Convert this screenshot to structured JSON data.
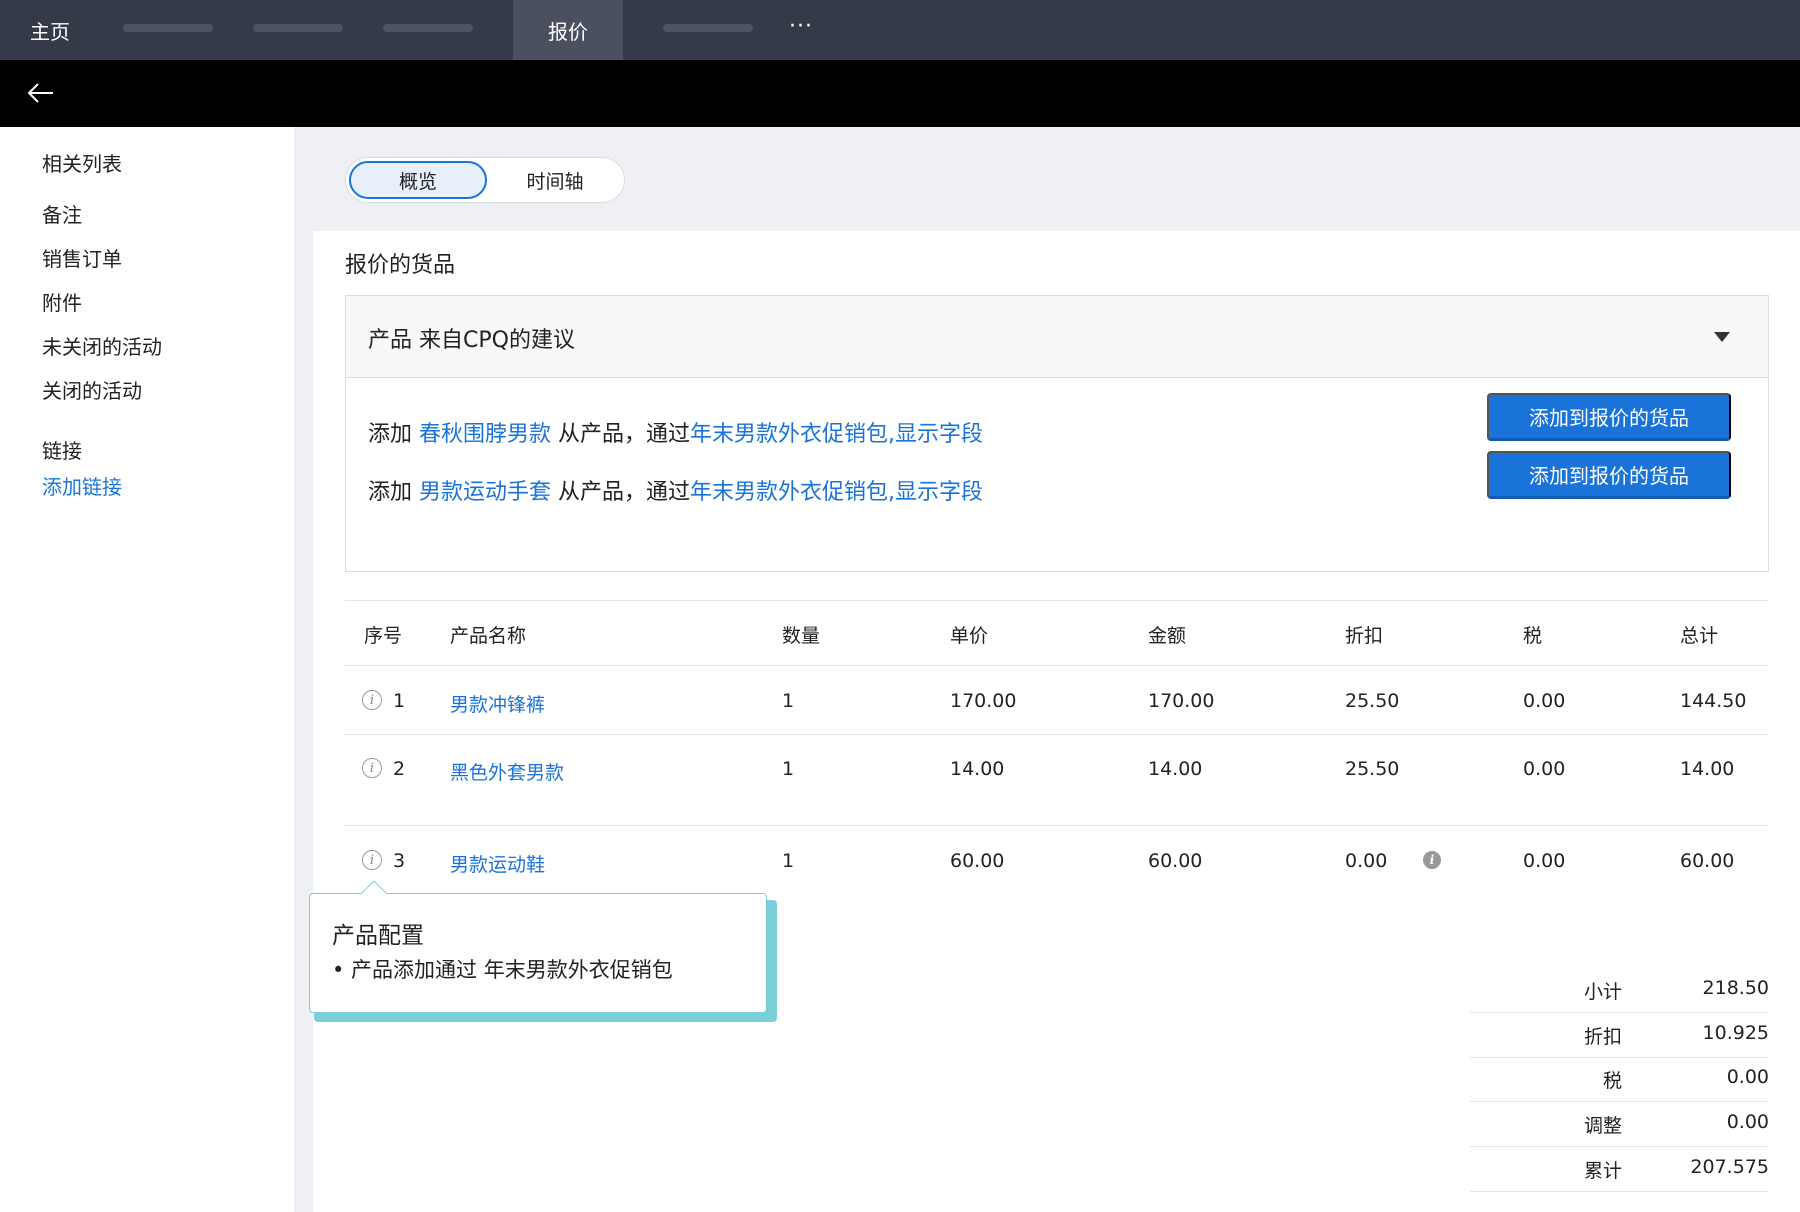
{
  "topnav": {
    "home": "主页",
    "quote": "报价",
    "more": "···"
  },
  "sidebar": {
    "items": [
      "相关列表",
      "备注",
      "销售订单",
      "附件",
      "未关闭的活动",
      "关闭的活动",
      "链接"
    ],
    "add_link": "添加链接"
  },
  "view_toggle": {
    "overview": "概览",
    "timeline": "时间轴"
  },
  "section_title": "报价的货品",
  "suggestions": {
    "title": "产品 来自CPQ的建议",
    "lines": [
      {
        "prefix": "添加 ",
        "product": "春秋围脖男款",
        "middle": " 从产品，通过",
        "bundle": "年末男款外衣促销包,显示字段",
        "button": "添加到报价的货品"
      },
      {
        "prefix": "添加 ",
        "product": "男款运动手套",
        "middle": " 从产品，通过",
        "bundle": "年末男款外衣促销包,显示字段",
        "button": "添加到报价的货品"
      }
    ]
  },
  "table": {
    "headers": [
      "序号",
      "产品名称",
      "数量",
      "单价",
      "金额",
      "折扣",
      "税",
      "总计"
    ],
    "rows": [
      {
        "no": "1",
        "name": "男款冲锋裤",
        "qty": "1",
        "price": "170.00",
        "amount": "170.00",
        "discount": "25.50",
        "tax": "0.00",
        "total": "144.50"
      },
      {
        "no": "2",
        "name": "黑色外套男款",
        "qty": "1",
        "price": "14.00",
        "amount": "14.00",
        "discount": "25.50",
        "tax": "0.00",
        "total": "14.00"
      },
      {
        "no": "3",
        "name": "男款运动鞋",
        "qty": "1",
        "price": "60.00",
        "amount": "60.00",
        "discount": "0.00",
        "tax": "0.00",
        "total": "60.00"
      }
    ]
  },
  "tooltip": {
    "title": "产品配置",
    "body": "• 产品添加通过 年末男款外衣促销包"
  },
  "summary": [
    {
      "label": "小计",
      "value": "218.50"
    },
    {
      "label": "折扣",
      "value": "10.925"
    },
    {
      "label": "税",
      "value": "0.00"
    },
    {
      "label": "调整",
      "value": "0.00"
    },
    {
      "label": "累计",
      "value": "207.575"
    }
  ]
}
